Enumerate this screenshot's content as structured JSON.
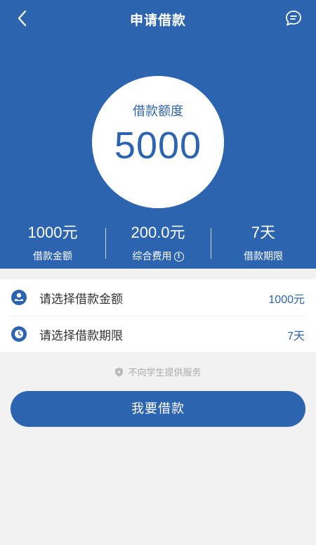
{
  "nav": {
    "title": "申请借款"
  },
  "credit": {
    "label": "借款额度",
    "value": "5000"
  },
  "stats": [
    {
      "value": "1000元",
      "label": "借款金额"
    },
    {
      "value": "200.0元",
      "label": "综合费用"
    },
    {
      "value": "7天",
      "label": "借款期限"
    }
  ],
  "options": [
    {
      "label": "请选择借款金额",
      "value": "1000元"
    },
    {
      "label": "请选择借款期限",
      "value": "7天"
    }
  ],
  "notice": "不向学生提供服务",
  "apply_button": "我要借款",
  "colors": {
    "primary": "#2c64b0",
    "background": "#f2f2f2"
  }
}
